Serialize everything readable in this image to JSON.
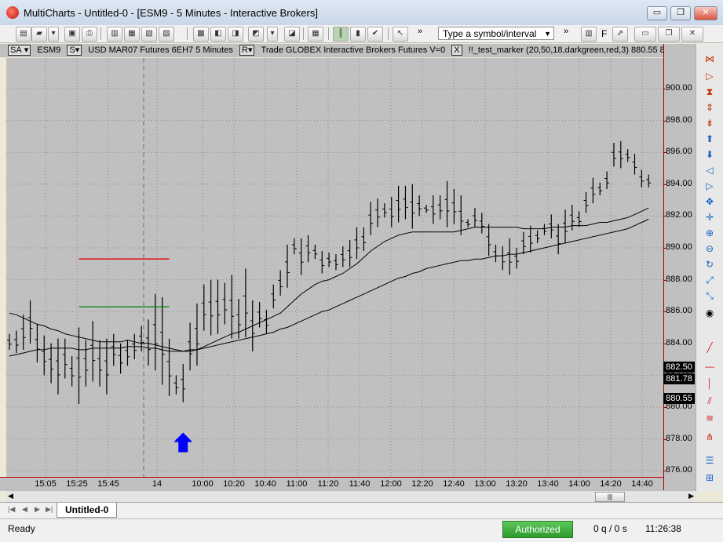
{
  "window": {
    "title": "MultiCharts - Untitled-0 - [ESM9 - 5 Minutes - Interactive Brokers]",
    "minimize_glyph": "▭",
    "restore_glyph": "❐",
    "close_glyph": "✕"
  },
  "toolbar": {
    "symbol_combo": "Type a symbol/interval",
    "trailing_letter": "F",
    "overflow_glyph": "»"
  },
  "chart_info": {
    "sa_label": "SA",
    "symbol": "ESM9",
    "s_label": "S",
    "description": "USD MAR07  Futures 6EH7  5 Minutes",
    "r_label": "R",
    "details": "Trade  GLOBEX  Interactive Brokers  Futures  V=0",
    "close_box": "X",
    "indicator": "!!_test_marker  (20,50,18,darkgreen,red,3)  880.55  8"
  },
  "price_axis": {
    "labels": [
      "900.00",
      "898.00",
      "896.00",
      "894.00",
      "892.00",
      "890.00",
      "888.00",
      "886.00",
      "884.00",
      "882.00",
      "880.00",
      "878.00",
      "876.00"
    ],
    "tags": [
      "882.50",
      "881.78",
      "880.55"
    ]
  },
  "time_axis": {
    "labels": [
      "15:05",
      "15:25",
      "15:45",
      "14",
      "10:00",
      "10:20",
      "10:40",
      "11:00",
      "11:20",
      "11:40",
      "12:00",
      "12:20",
      "12:40",
      "13:00",
      "13:20",
      "13:40",
      "14:00",
      "14:20",
      "14:40"
    ]
  },
  "tabs": {
    "nav_glyphs": [
      "|◀",
      "◀",
      "▶",
      "▶|"
    ],
    "active": "Untitled-0"
  },
  "status": {
    "left": "Ready",
    "authorized": "Authorized",
    "queue": "0 q / 0 s",
    "clock": "11:26:38"
  },
  "colors": {
    "chart_bg": "#c0c0c0",
    "bars": "#000000",
    "red_line": "#e00000",
    "green_line": "#008000",
    "arrow": "#0000ff",
    "authorized_bg": "#3aa83a"
  },
  "chart_data": {
    "type": "ohlc",
    "title": "",
    "x_tick_labels": [
      "15:05",
      "15:25",
      "15:45",
      "14",
      "10:00",
      "10:20",
      "10:40",
      "11:00",
      "11:20",
      "11:40",
      "12:00",
      "12:20",
      "12:40",
      "13:00",
      "13:20",
      "13:40",
      "14:00",
      "14:20",
      "14:40"
    ],
    "ylim": [
      875,
      901.5
    ],
    "y_ticks": [
      876,
      878,
      880,
      882,
      884,
      886,
      888,
      890,
      892,
      894,
      896,
      898,
      900
    ],
    "grid": true,
    "bars_low_high": [
      [
        883.6,
        884.6
      ],
      [
        883.4,
        884.8
      ],
      [
        883.6,
        885.8
      ],
      [
        884,
        886.7
      ],
      [
        882.8,
        885.2
      ],
      [
        882,
        884.5
      ],
      [
        881.5,
        884
      ],
      [
        880.8,
        884.3
      ],
      [
        881.8,
        884.3
      ],
      [
        881.3,
        883.2
      ],
      [
        880.2,
        885
      ],
      [
        881.3,
        884.2
      ],
      [
        881.6,
        885.4
      ],
      [
        881.3,
        884.2
      ],
      [
        880.8,
        884.3
      ],
      [
        882.6,
        884.6
      ],
      [
        882.1,
        884
      ],
      [
        882.6,
        884.2
      ],
      [
        883,
        884.6
      ],
      [
        883.5,
        885.1
      ],
      [
        882.6,
        885.5
      ],
      [
        882.3,
        887.1
      ],
      [
        881.4,
        886.9
      ],
      [
        880.7,
        884.3
      ],
      [
        880.8,
        882
      ],
      [
        880.3,
        882.7
      ],
      [
        882.3,
        885.3
      ],
      [
        882.6,
        886.5
      ],
      [
        884.8,
        887.7
      ],
      [
        884.5,
        888
      ],
      [
        884.6,
        888
      ],
      [
        885.2,
        887.8
      ],
      [
        884.3,
        888.3
      ],
      [
        884.3,
        886.8
      ],
      [
        884.4,
        888.7
      ],
      [
        883.5,
        886.7
      ],
      [
        885,
        886.6
      ],
      [
        884.6,
        886.1
      ],
      [
        886.2,
        887.7
      ],
      [
        887,
        888.6
      ],
      [
        887.5,
        890.2
      ],
      [
        889.6,
        890.6
      ],
      [
        888.3,
        890.6
      ],
      [
        889.1,
        890.8
      ],
      [
        889.3,
        890.2
      ],
      [
        888.4,
        889.8
      ],
      [
        888.8,
        889.7
      ],
      [
        888.6,
        889.6
      ],
      [
        888.8,
        890.1
      ],
      [
        888.8,
        890.5
      ],
      [
        889.3,
        891.3
      ],
      [
        889.8,
        891.3
      ],
      [
        890.8,
        892.9
      ],
      [
        891.3,
        893.1
      ],
      [
        891.9,
        892.8
      ],
      [
        891.3,
        893.2
      ],
      [
        891.6,
        893.9
      ],
      [
        891.8,
        893.9
      ],
      [
        891.2,
        894
      ],
      [
        892,
        893.3
      ],
      [
        892.2,
        892.7
      ],
      [
        891.5,
        893.3
      ],
      [
        891.8,
        893.3
      ],
      [
        891.3,
        894.2
      ],
      [
        891.5,
        893.7
      ],
      [
        890.8,
        893.3
      ],
      [
        891.3,
        891.8
      ],
      [
        891.3,
        892.5
      ],
      [
        890.9,
        892.2
      ],
      [
        889.5,
        891.5
      ],
      [
        889.1,
        890.2
      ],
      [
        888.6,
        890.1
      ],
      [
        888.3,
        890.6
      ],
      [
        888.7,
        890
      ],
      [
        889.6,
        891
      ],
      [
        889.7,
        891.4
      ],
      [
        890.3,
        891.1
      ],
      [
        890.8,
        891.5
      ],
      [
        890.6,
        892.1
      ],
      [
        889.6,
        891.5
      ],
      [
        890.3,
        892.4
      ],
      [
        891.1,
        892.7
      ],
      [
        891.3,
        892.3
      ],
      [
        892.2,
        893.5
      ],
      [
        892.8,
        894.4
      ],
      [
        893.3,
        894.1
      ],
      [
        893.7,
        894.8
      ],
      [
        895.1,
        896.6
      ],
      [
        895,
        896.7
      ],
      [
        895.4,
        896.2
      ],
      [
        894.6,
        895.9
      ],
      [
        893.8,
        894.9
      ],
      [
        893.8,
        894.6
      ]
    ],
    "series": [
      {
        "values": [
          885.9,
          885.8,
          885.6,
          885.4,
          885.2,
          885.1,
          884.9,
          884.8,
          884.6,
          884.5,
          884.4,
          884.3,
          884.2,
          884.1,
          884.1,
          884.1,
          884.1,
          884.2,
          884.1,
          884,
          884,
          883.9,
          883.8,
          883.7,
          883.6,
          883.5,
          883.5,
          883.6,
          883.8,
          884,
          884.2,
          884.4,
          884.6,
          884.7,
          884.9,
          885.1,
          885.3,
          885.5,
          885.7,
          885.9,
          886.3,
          886.7,
          887.1,
          887.4,
          887.7,
          887.9,
          888,
          888.2,
          888.4,
          888.7,
          889,
          889.4,
          889.8,
          890.1,
          890.4,
          890.6,
          890.8,
          890.9,
          891,
          891,
          891,
          891,
          891,
          891,
          891,
          891.1,
          891.2,
          891.3,
          891.3,
          891.3,
          891.3,
          891.3,
          891.3,
          891.3,
          891.2,
          891.2,
          891.2,
          891.2,
          891.3,
          891.3,
          891.3,
          891.4,
          891.4,
          891.4,
          891.5,
          891.6,
          891.6,
          891.7,
          891.8,
          891.9,
          892.1,
          892.3,
          892.5
        ]
      },
      {
        "values": [
          883.2,
          883.3,
          883.4,
          883.5,
          883.6,
          883.6,
          883.7,
          883.7,
          883.7,
          883.7,
          883.6,
          883.6,
          883.7,
          883.7,
          883.7,
          883.7,
          883.7,
          883.8,
          883.8,
          883.8,
          883.7,
          883.7,
          883.6,
          883.5,
          883.5,
          883.5,
          883.6,
          883.6,
          883.7,
          883.8,
          883.9,
          884,
          884.1,
          884.2,
          884.3,
          884.4,
          884.5,
          884.6,
          884.7,
          884.9,
          885,
          885.2,
          885.4,
          885.6,
          885.8,
          886,
          886.1,
          886.3,
          886.5,
          886.7,
          886.9,
          887.1,
          887.3,
          887.5,
          887.7,
          887.9,
          888.1,
          888.2,
          888.4,
          888.5,
          888.7,
          888.8,
          888.9,
          889,
          889.1,
          889.2,
          889.2,
          889.3,
          889.3,
          889.4,
          889.5,
          889.5,
          889.6,
          889.6,
          889.7,
          889.8,
          889.9,
          890,
          890.1,
          890.2,
          890.3,
          890.4,
          890.5,
          890.6,
          890.7,
          890.8,
          890.9,
          891,
          891.1,
          891.2,
          891.4,
          891.6,
          891.8
        ]
      }
    ],
    "horizontal_lines": [
      {
        "value": 889.3,
        "x_from": 10,
        "x_to": 23,
        "color": "red"
      },
      {
        "value": 886.3,
        "x_from": 10,
        "x_to": 23,
        "color": "green"
      }
    ],
    "marker": {
      "type": "arrow-up",
      "bar_index": 25,
      "value": 878.4
    }
  }
}
